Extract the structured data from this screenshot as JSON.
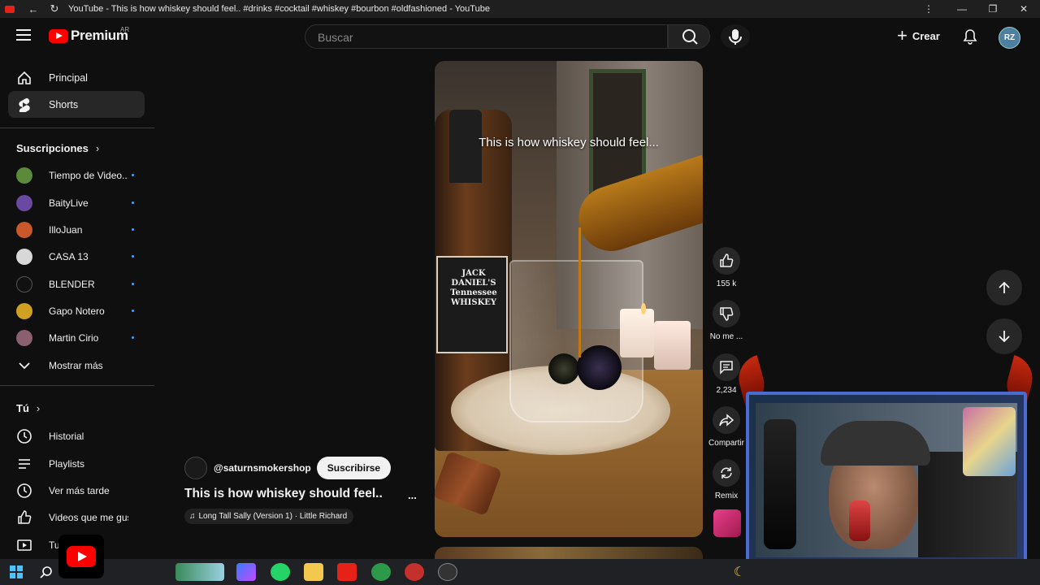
{
  "window": {
    "title": "YouTube - This is how whiskey should feel.. #drinks #cocktail #whiskey #bourbon #oldfashioned - YouTube"
  },
  "masthead": {
    "logo_text": "Premium",
    "country_code": "AR",
    "search_placeholder": "Buscar",
    "create_label": "Crear",
    "avatar_initials": "RZ"
  },
  "sidebar": {
    "main": [
      {
        "label": "Principal",
        "icon": "home-icon"
      },
      {
        "label": "Shorts",
        "icon": "shorts-icon",
        "active": true
      }
    ],
    "subscriptions_title": "Suscripciones",
    "subscriptions": [
      {
        "name": "Tiempo de Video...",
        "color": "#5a8a3a"
      },
      {
        "name": "BaityLive",
        "color": "#6a4aa0"
      },
      {
        "name": "IlloJuan",
        "color": "#c9582a"
      },
      {
        "name": "CASA 13",
        "color": "#d8d8d8"
      },
      {
        "name": "BLENDER",
        "color": "#111111"
      },
      {
        "name": "Gapo Notero",
        "color": "#d0a020"
      },
      {
        "name": "Martin Cirio",
        "color": "#8a6070"
      }
    ],
    "show_more": "Mostrar más",
    "you_title": "Tú",
    "you_items": [
      {
        "label": "Historial",
        "icon": "history-icon"
      },
      {
        "label": "Playlists",
        "icon": "playlist-icon"
      },
      {
        "label": "Ver más tarde",
        "icon": "clock-icon"
      },
      {
        "label": "Videos que me gus...",
        "icon": "thumbs-up-icon"
      },
      {
        "label": "Tu",
        "icon": "your-videos-icon"
      }
    ]
  },
  "short": {
    "caption": "This is how whiskey should feel...",
    "channel": "@saturnsmokershop",
    "subscribe_label": "Suscribirse",
    "title": "This is how whiskey should feel..",
    "more": "...",
    "music": "Long Tall Sally (Version 1) · Little Richard",
    "bottle_label": "JACK DANIEL'S Tennessee WHISKEY"
  },
  "actions": {
    "likes": "155 k",
    "dislike": "No me ...",
    "comments": "2,234",
    "share": "Compartir",
    "remix": "Remix"
  }
}
